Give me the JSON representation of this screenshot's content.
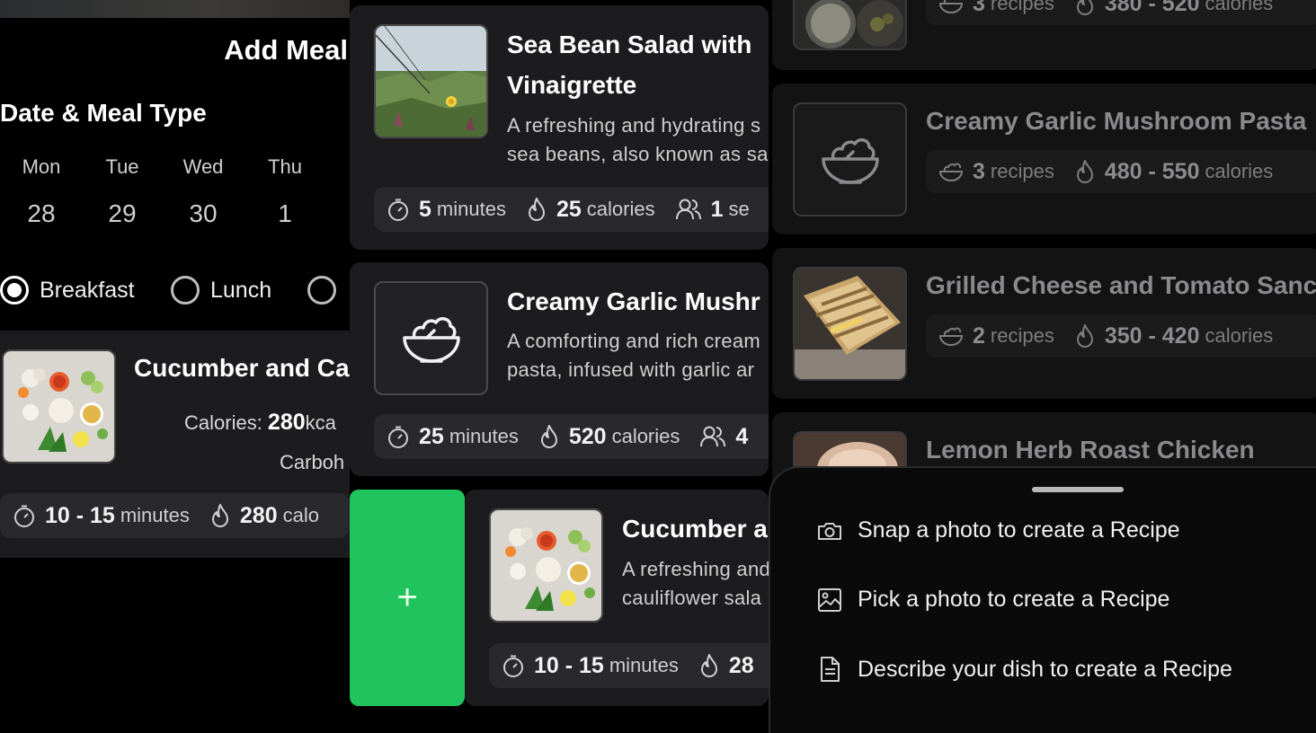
{
  "add_meal": {
    "title": "Add Meal",
    "section_title": "Date & Meal Type",
    "days": [
      {
        "name": "Mon",
        "date": "28"
      },
      {
        "name": "Tue",
        "date": "29"
      },
      {
        "name": "Wed",
        "date": "30"
      },
      {
        "name": "Thu",
        "date": "1"
      }
    ],
    "meal_types": [
      {
        "label": "Breakfast",
        "selected": true
      },
      {
        "label": "Lunch",
        "selected": false
      },
      {
        "label": "",
        "selected": false
      }
    ],
    "selected_recipe": {
      "title": "Cucumber and Ca",
      "calories_label": "Calories: ",
      "calories_value": "280",
      "calories_unit": "kca",
      "carbs_label": "Carboh",
      "time_value": "10 - 15",
      "time_unit": "minutes",
      "cal_value": "280",
      "cal_unit": "calo"
    }
  },
  "recipes": [
    {
      "title_lines": [
        "Sea Bean Salad with",
        "Vinaigrette"
      ],
      "desc_lines": [
        "A refreshing and hydrating s",
        "sea beans, also known as sa"
      ],
      "time_value": "5",
      "time_unit": "minutes",
      "cal_value": "25",
      "cal_unit": "calories",
      "serv_value": "1",
      "serv_unit": "se"
    },
    {
      "title_lines": [
        "Creamy Garlic Mushr"
      ],
      "desc_lines": [
        "A comforting and rich cream",
        "pasta, infused with garlic ar"
      ],
      "time_value": "25",
      "time_unit": "minutes",
      "cal_value": "520",
      "cal_unit": "calories",
      "serv_value": "4",
      "serv_unit": ""
    },
    {
      "title_lines": [
        "Cucumber a"
      ],
      "desc_lines": [
        "A refreshing and",
        "cauliflower sala"
      ],
      "time_value": "10 - 15",
      "time_unit": "minutes",
      "cal_value": "28",
      "cal_unit": ""
    }
  ],
  "add_button": {
    "label": "+"
  },
  "recipe_groups": [
    {
      "title": "",
      "count_value": "3",
      "count_unit": "recipes",
      "cal_range": "380 - 520",
      "cal_unit": "calories"
    },
    {
      "title": "Creamy Garlic Mushroom Pasta",
      "count_value": "3",
      "count_unit": "recipes",
      "cal_range": "480 - 550",
      "cal_unit": "calories"
    },
    {
      "title": "Grilled Cheese and Tomato Sanc",
      "count_value": "2",
      "count_unit": "recipes",
      "cal_range": "350 - 420",
      "cal_unit": "calories"
    },
    {
      "title": "Lemon Herb Roast Chicken"
    }
  ],
  "sheet": {
    "options": [
      {
        "label": "Snap a photo to create a Recipe",
        "icon": "camera-icon"
      },
      {
        "label": "Pick a photo to create a Recipe",
        "icon": "image-icon"
      },
      {
        "label": "Describe your dish to create a Recipe",
        "icon": "document-icon"
      }
    ]
  },
  "colors": {
    "accent_green": "#20c45c",
    "card_bg": "#1c1c1e",
    "chip_bg": "#29292c"
  }
}
